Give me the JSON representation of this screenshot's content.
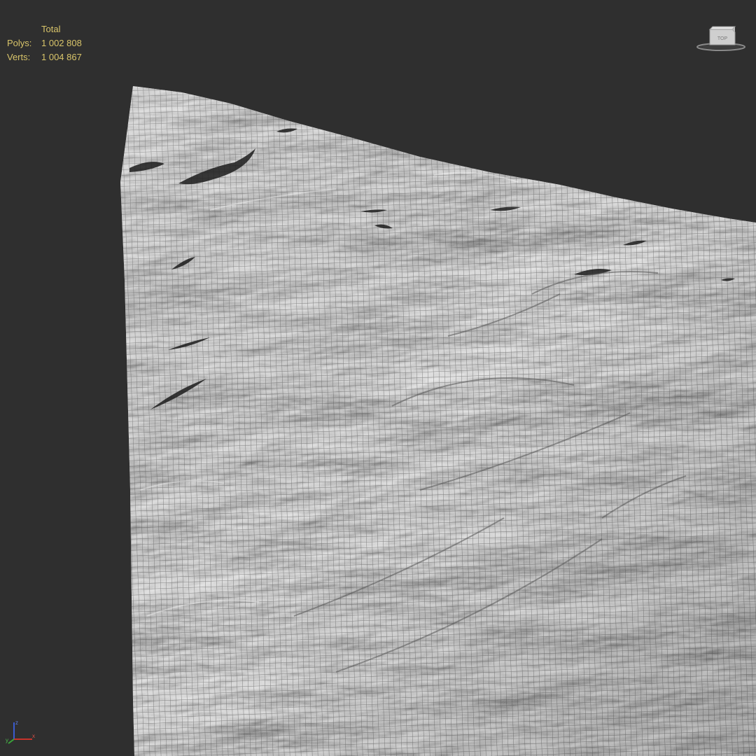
{
  "stats": {
    "header": "Total",
    "polys_label": "Polys:",
    "polys_value": "1 002 808",
    "verts_label": "Verts:",
    "verts_value": "1 004 867"
  },
  "viewcube": {
    "face_label": "TOP"
  },
  "axis": {
    "x": "x",
    "y": "y",
    "z": "z"
  },
  "colors": {
    "viewport_bg": "#2f2f2f",
    "stats_text": "#d8c46a",
    "mesh_base": "#9a9a9a",
    "mesh_wire": "#3a3a3a",
    "axis_x": "#c8332b",
    "axis_y": "#3aa53a",
    "axis_z": "#3a5bd0"
  },
  "icons": [
    "viewcube-icon",
    "axis-tripod-icon"
  ]
}
